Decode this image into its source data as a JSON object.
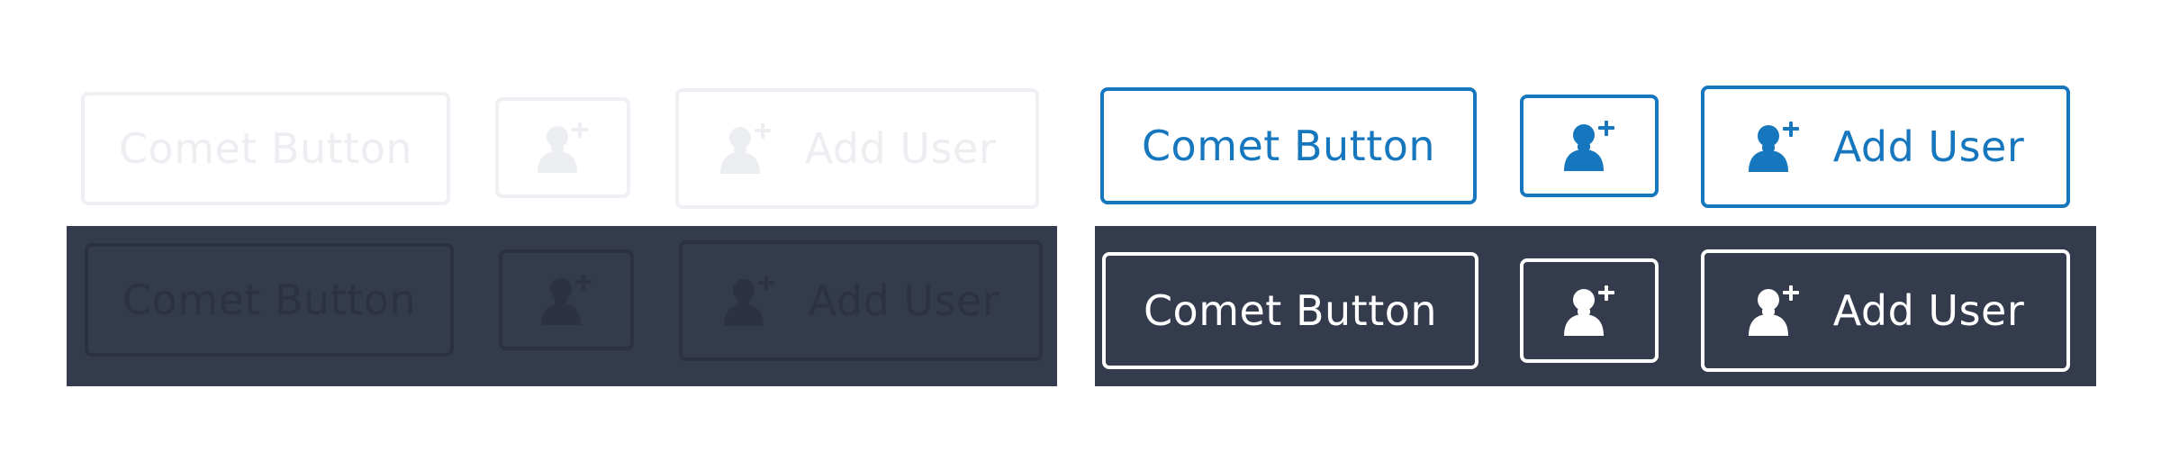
{
  "colors": {
    "background": "#ffffff",
    "dark_panel": "#343b4c",
    "accent_blue": "#1677be",
    "disabled_light": "#eceef2",
    "disabled_dark": "#2c3241",
    "white": "#ffffff"
  },
  "groups": {
    "disabled_light": {
      "state": "disabled",
      "text_button": {
        "label": "Comet Button"
      },
      "icon_button": {
        "icon": "add-user-icon"
      },
      "icon_text_button": {
        "icon": "add-user-icon",
        "label": "Add User"
      }
    },
    "disabled_dark": {
      "state": "disabled",
      "text_button": {
        "label": "Comet Button"
      },
      "icon_button": {
        "icon": "add-user-icon"
      },
      "icon_text_button": {
        "icon": "add-user-icon",
        "label": "Add User"
      }
    },
    "active_light": {
      "state": "active",
      "text_button": {
        "label": "Comet Button"
      },
      "icon_button": {
        "icon": "add-user-icon"
      },
      "icon_text_button": {
        "icon": "add-user-icon",
        "label": "Add User"
      }
    },
    "active_dark": {
      "state": "active",
      "text_button": {
        "label": "Comet Button"
      },
      "icon_button": {
        "icon": "add-user-icon"
      },
      "icon_text_button": {
        "icon": "add-user-icon",
        "label": "Add User"
      }
    }
  }
}
